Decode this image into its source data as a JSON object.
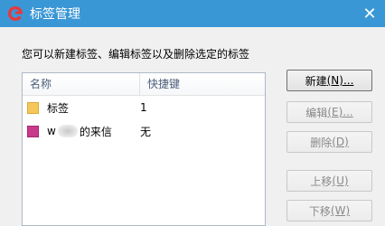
{
  "window": {
    "title": "标签管理",
    "close_glyph": "✕",
    "titlebar_color": "#3a97d6"
  },
  "instruction": "您可以新建标签、编辑标签以及删除选定的标签",
  "list": {
    "columns": {
      "name": "名称",
      "shortcut": "快捷键"
    },
    "rows": [
      {
        "name_prefix": "标签",
        "name_suffix": "",
        "shortcut": "1",
        "color": "#f5c75a",
        "blurred": false
      },
      {
        "name_prefix": "w",
        "name_suffix": "的来信",
        "shortcut": "无",
        "color": "#c93a8c",
        "blurred": true
      }
    ]
  },
  "buttons": {
    "new": {
      "label": "新建",
      "accel": "(N)...",
      "enabled": true
    },
    "edit": {
      "label": "编辑",
      "accel": "(E)...",
      "enabled": false
    },
    "delete": {
      "label": "删除",
      "accel": "(D)",
      "enabled": false
    },
    "up": {
      "label": "上移",
      "accel": "(U)",
      "enabled": false
    },
    "down": {
      "label": "下移",
      "accel": "(W)",
      "enabled": false
    }
  },
  "icons": {
    "app": "foxmail-logo-icon",
    "close": "close-icon",
    "tag": "tag-color-swatch-icon"
  }
}
